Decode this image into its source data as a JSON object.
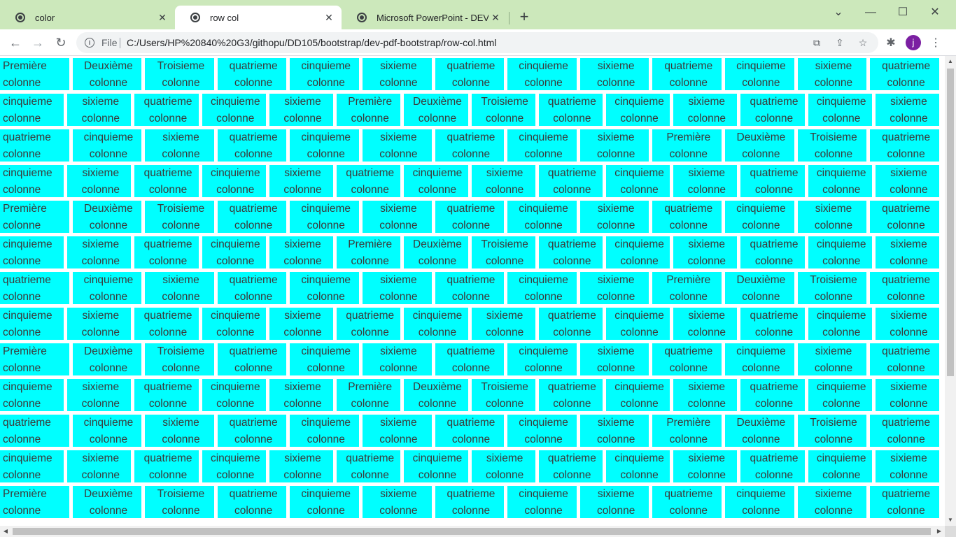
{
  "browser": {
    "tabs": [
      {
        "title": "color",
        "icon": "globe-icon",
        "active": false
      },
      {
        "title": "row col",
        "icon": "globe-icon",
        "active": true
      },
      {
        "title": "Microsoft PowerPoint - DEV_TS_C",
        "icon": "globe-icon",
        "active": false
      }
    ],
    "new_tab": "+",
    "window_controls": {
      "tab_search": "⌄",
      "minimize": "—",
      "maximize": "☐",
      "close": "✕"
    },
    "nav": {
      "back": "←",
      "forward": "→",
      "reload": "↻"
    },
    "omnibox": {
      "scheme_label": "File",
      "url": "C:/Users/HP%20840%20G3/githopu/DD105/bootstrap/dev-pdf-bootstrap/row-col.html"
    },
    "profile_initial": "j",
    "colors": {
      "tabbar": "#cce8bb",
      "cell": "#00ffff",
      "avatar": "#7b1fa2"
    }
  },
  "page": {
    "rows": [
      [
        "Première colonne",
        "Deuxième colonne",
        "Troisieme colonne",
        "quatrieme colonne",
        "cinquieme colonne",
        "sixieme colonne",
        "quatrieme colonne",
        "cinquieme colonne",
        "sixieme colonne",
        "quatrieme colonne",
        "cinquieme colonne",
        "sixieme colonne",
        "quatrieme colonne"
      ],
      [
        "cinquieme colonne",
        "sixieme colonne",
        "quatrieme colonne",
        "cinquieme colonne",
        "sixieme colonne",
        "Première colonne",
        "Deuxième colonne",
        "Troisieme colonne",
        "quatrieme colonne",
        "cinquieme colonne",
        "sixieme colonne",
        "quatrieme colonne",
        "cinquieme colonne",
        "sixieme colonne"
      ],
      [
        "quatrieme colonne",
        "cinquieme colonne",
        "sixieme colonne",
        "quatrieme colonne",
        "cinquieme colonne",
        "sixieme colonne",
        "quatrieme colonne",
        "cinquieme colonne",
        "sixieme colonne",
        "Première colonne",
        "Deuxième colonne",
        "Troisieme colonne",
        "quatrieme colonne"
      ],
      [
        "cinquieme colonne",
        "sixieme colonne",
        "quatrieme colonne",
        "cinquieme colonne",
        "sixieme colonne",
        "quatrieme colonne",
        "cinquieme colonne",
        "sixieme colonne",
        "quatrieme colonne",
        "cinquieme colonne",
        "sixieme colonne",
        "quatrieme colonne",
        "cinquieme colonne",
        "sixieme colonne"
      ],
      [
        "Première colonne",
        "Deuxième colonne",
        "Troisieme colonne",
        "quatrieme colonne",
        "cinquieme colonne",
        "sixieme colonne",
        "quatrieme colonne",
        "cinquieme colonne",
        "sixieme colonne",
        "quatrieme colonne",
        "cinquieme colonne",
        "sixieme colonne",
        "quatrieme colonne"
      ],
      [
        "cinquieme colonne",
        "sixieme colonne",
        "quatrieme colonne",
        "cinquieme colonne",
        "sixieme colonne",
        "Première colonne",
        "Deuxième colonne",
        "Troisieme colonne",
        "quatrieme colonne",
        "cinquieme colonne",
        "sixieme colonne",
        "quatrieme colonne",
        "cinquieme colonne",
        "sixieme colonne"
      ],
      [
        "quatrieme colonne",
        "cinquieme colonne",
        "sixieme colonne",
        "quatrieme colonne",
        "cinquieme colonne",
        "sixieme colonne",
        "quatrieme colonne",
        "cinquieme colonne",
        "sixieme colonne",
        "Première colonne",
        "Deuxième colonne",
        "Troisieme colonne",
        "quatrieme colonne"
      ],
      [
        "cinquieme colonne",
        "sixieme colonne",
        "quatrieme colonne",
        "cinquieme colonne",
        "sixieme colonne",
        "quatrieme colonne",
        "cinquieme colonne",
        "sixieme colonne",
        "quatrieme colonne",
        "cinquieme colonne",
        "sixieme colonne",
        "quatrieme colonne",
        "cinquieme colonne",
        "sixieme colonne"
      ],
      [
        "Première colonne",
        "Deuxième colonne",
        "Troisieme colonne",
        "quatrieme colonne",
        "cinquieme colonne",
        "sixieme colonne",
        "quatrieme colonne",
        "cinquieme colonne",
        "sixieme colonne",
        "quatrieme colonne",
        "cinquieme colonne",
        "sixieme colonne",
        "quatrieme colonne"
      ],
      [
        "cinquieme colonne",
        "sixieme colonne",
        "quatrieme colonne",
        "cinquieme colonne",
        "sixieme colonne",
        "Première colonne",
        "Deuxième colonne",
        "Troisieme colonne",
        "quatrieme colonne",
        "cinquieme colonne",
        "sixieme colonne",
        "quatrieme colonne",
        "cinquieme colonne",
        "sixieme colonne"
      ],
      [
        "quatrieme colonne",
        "cinquieme colonne",
        "sixieme colonne",
        "quatrieme colonne",
        "cinquieme colonne",
        "sixieme colonne",
        "quatrieme colonne",
        "cinquieme colonne",
        "sixieme colonne",
        "Première colonne",
        "Deuxième colonne",
        "Troisieme colonne",
        "quatrieme colonne"
      ],
      [
        "cinquieme colonne",
        "sixieme colonne",
        "quatrieme colonne",
        "cinquieme colonne",
        "sixieme colonne",
        "quatrieme colonne",
        "cinquieme colonne",
        "sixieme colonne",
        "quatrieme colonne",
        "cinquieme colonne",
        "sixieme colonne",
        "quatrieme colonne",
        "cinquieme colonne",
        "sixieme colonne"
      ],
      [
        "Première colonne",
        "Deuxième colonne",
        "Troisieme colonne",
        "quatrieme colonne",
        "cinquieme colonne",
        "sixieme colonne",
        "quatrieme colonne",
        "cinquieme colonne",
        "sixieme colonne",
        "quatrieme colonne",
        "cinquieme colonne",
        "sixieme colonne",
        "quatrieme colonne"
      ]
    ]
  }
}
